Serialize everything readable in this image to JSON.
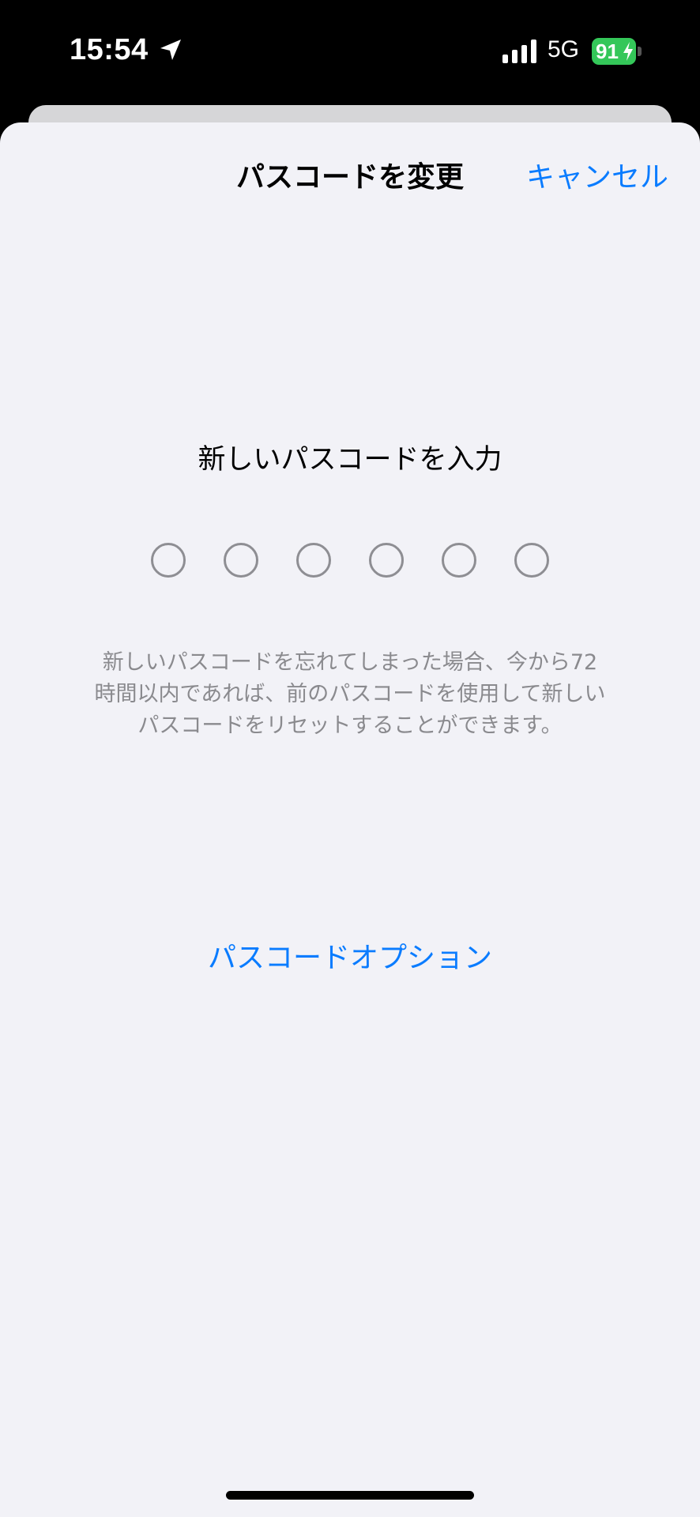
{
  "status_bar": {
    "time": "15:54",
    "network": "5G",
    "battery_level": "91",
    "icons": [
      "location-arrow-icon",
      "signal-bars-icon",
      "battery-charging-icon"
    ],
    "battery_color": "#34c759"
  },
  "sheet": {
    "title": "パスコードを変更",
    "cancel_label": "キャンセル",
    "prompt": "新しいパスコードを入力",
    "passcode_length": 6,
    "info_lines": [
      "新しいパスコードを忘れてしまった場合、今から72",
      "時間以内であれば、前のパスコードを使用して新しい",
      "パスコードをリセットすることができます。"
    ],
    "options_label": "パスコードオプション"
  },
  "colors": {
    "accent": "#0a7cff",
    "sheet_background": "#f2f2f7",
    "secondary_text": "#8a8a8e",
    "dot_stroke": "#8e8e93"
  }
}
